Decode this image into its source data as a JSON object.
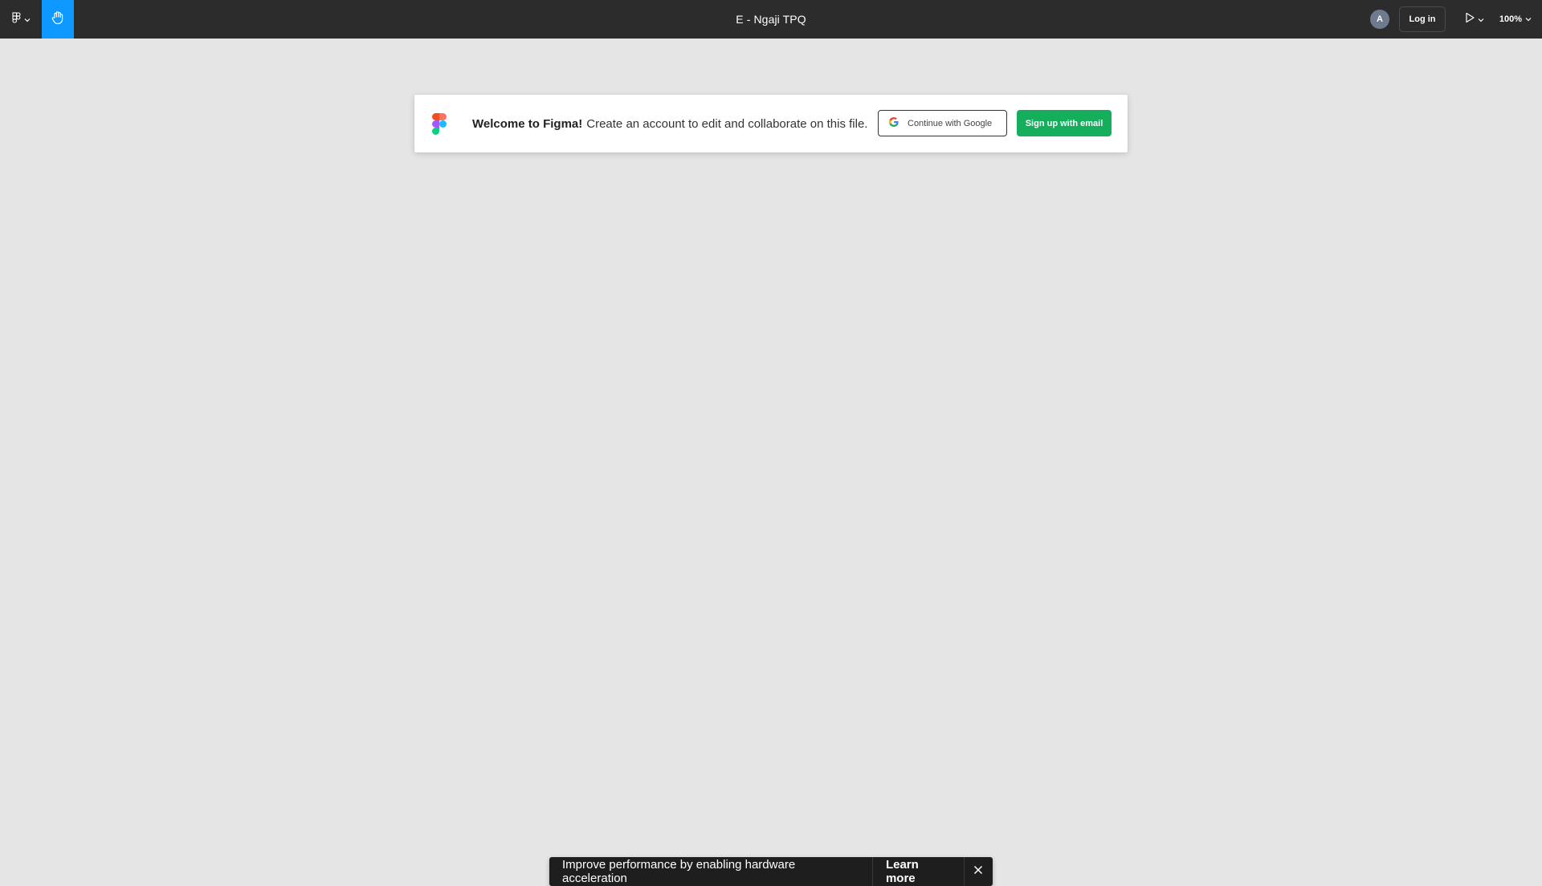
{
  "topbar": {
    "file_title": "E - Ngaji TPQ",
    "menu_icon": "figma-menu-icon",
    "tool_icon": "hand-icon",
    "avatar_initial": "A",
    "login_label": "Log in",
    "present_icon": "play-icon",
    "zoom_level": "100%"
  },
  "banner": {
    "welcome_bold": "Welcome to Figma!",
    "welcome_text": "Create an account to edit and collaborate on this file.",
    "google_label": "Continue with Google",
    "email_label": "Sign up with email"
  },
  "toast": {
    "message": "Improve performance by enabling hardware acceleration",
    "action_label": "Learn more"
  },
  "colors": {
    "topbar_bg": "#2c2c2c",
    "canvas_bg": "#e5e5e5",
    "accent_blue": "#0d99ff",
    "signup_green": "#14ae5c"
  }
}
